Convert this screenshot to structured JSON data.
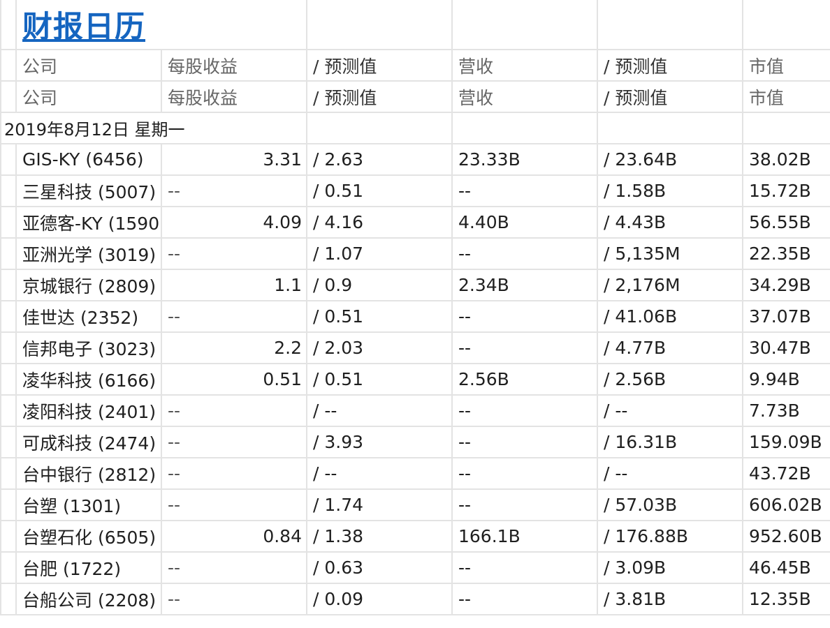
{
  "page": {
    "title": "财报日历"
  },
  "headers": {
    "company": "公司",
    "eps": "每股收益",
    "eps_forecast": "/ 预测值",
    "revenue": "营收",
    "revenue_forecast": "/ 预测值",
    "market_cap": "市值"
  },
  "date_heading": "2019年8月12日 星期一",
  "rows": [
    {
      "company": "GIS-KY (6456)",
      "eps": "3.31",
      "eps_forecast": "/ 2.63",
      "revenue": "23.33B",
      "revenue_forecast": "/ 23.64B",
      "market_cap": "38.02B"
    },
    {
      "company": "三星科技 (5007)",
      "eps": "--",
      "eps_forecast": "/ 0.51",
      "revenue": "--",
      "revenue_forecast": "/ 1.58B",
      "market_cap": "15.72B"
    },
    {
      "company": "亚德客-KY (1590",
      "eps": "4.09",
      "eps_forecast": "/ 4.16",
      "revenue": "4.40B",
      "revenue_forecast": "/ 4.43B",
      "market_cap": "56.55B"
    },
    {
      "company": "亚洲光学 (3019)",
      "eps": "--",
      "eps_forecast": "/ 1.07",
      "revenue": "--",
      "revenue_forecast": "/ 5,135M",
      "market_cap": "22.35B"
    },
    {
      "company": "京城银行 (2809)",
      "eps": "1.1",
      "eps_forecast": "/ 0.9",
      "revenue": "2.34B",
      "revenue_forecast": "/ 2,176M",
      "market_cap": "34.29B"
    },
    {
      "company": "佳世达 (2352)",
      "eps": "--",
      "eps_forecast": "/ 0.51",
      "revenue": "--",
      "revenue_forecast": "/ 41.06B",
      "market_cap": "37.07B"
    },
    {
      "company": "信邦电子 (3023)",
      "eps": "2.2",
      "eps_forecast": "/ 2.03",
      "revenue": "--",
      "revenue_forecast": "/ 4.77B",
      "market_cap": "30.47B"
    },
    {
      "company": "凌华科技 (6166)",
      "eps": "0.51",
      "eps_forecast": "/ 0.51",
      "revenue": "2.56B",
      "revenue_forecast": "/ 2.56B",
      "market_cap": "9.94B"
    },
    {
      "company": "凌阳科技 (2401)",
      "eps": "--",
      "eps_forecast": "/ --",
      "revenue": "--",
      "revenue_forecast": "/ --",
      "market_cap": "7.73B"
    },
    {
      "company": "可成科技 (2474)",
      "eps": "--",
      "eps_forecast": "/ 3.93",
      "revenue": "--",
      "revenue_forecast": "/ 16.31B",
      "market_cap": "159.09B"
    },
    {
      "company": "台中银行 (2812)",
      "eps": "--",
      "eps_forecast": "/ --",
      "revenue": "--",
      "revenue_forecast": "/ --",
      "market_cap": "43.72B"
    },
    {
      "company": "台塑 (1301)",
      "eps": "--",
      "eps_forecast": "/ 1.74",
      "revenue": "--",
      "revenue_forecast": "/ 57.03B",
      "market_cap": "606.02B"
    },
    {
      "company": "台塑石化 (6505)",
      "eps": "0.84",
      "eps_forecast": "/ 1.38",
      "revenue": "166.1B",
      "revenue_forecast": "/ 176.88B",
      "market_cap": "952.60B"
    },
    {
      "company": "台肥 (1722)",
      "eps": "--",
      "eps_forecast": "/ 0.63",
      "revenue": "--",
      "revenue_forecast": "/ 3.09B",
      "market_cap": "46.45B"
    },
    {
      "company": "台船公司 (2208)",
      "eps": "--",
      "eps_forecast": "/ 0.09",
      "revenue": "--",
      "revenue_forecast": "/ 3.81B",
      "market_cap": "12.35B"
    }
  ]
}
